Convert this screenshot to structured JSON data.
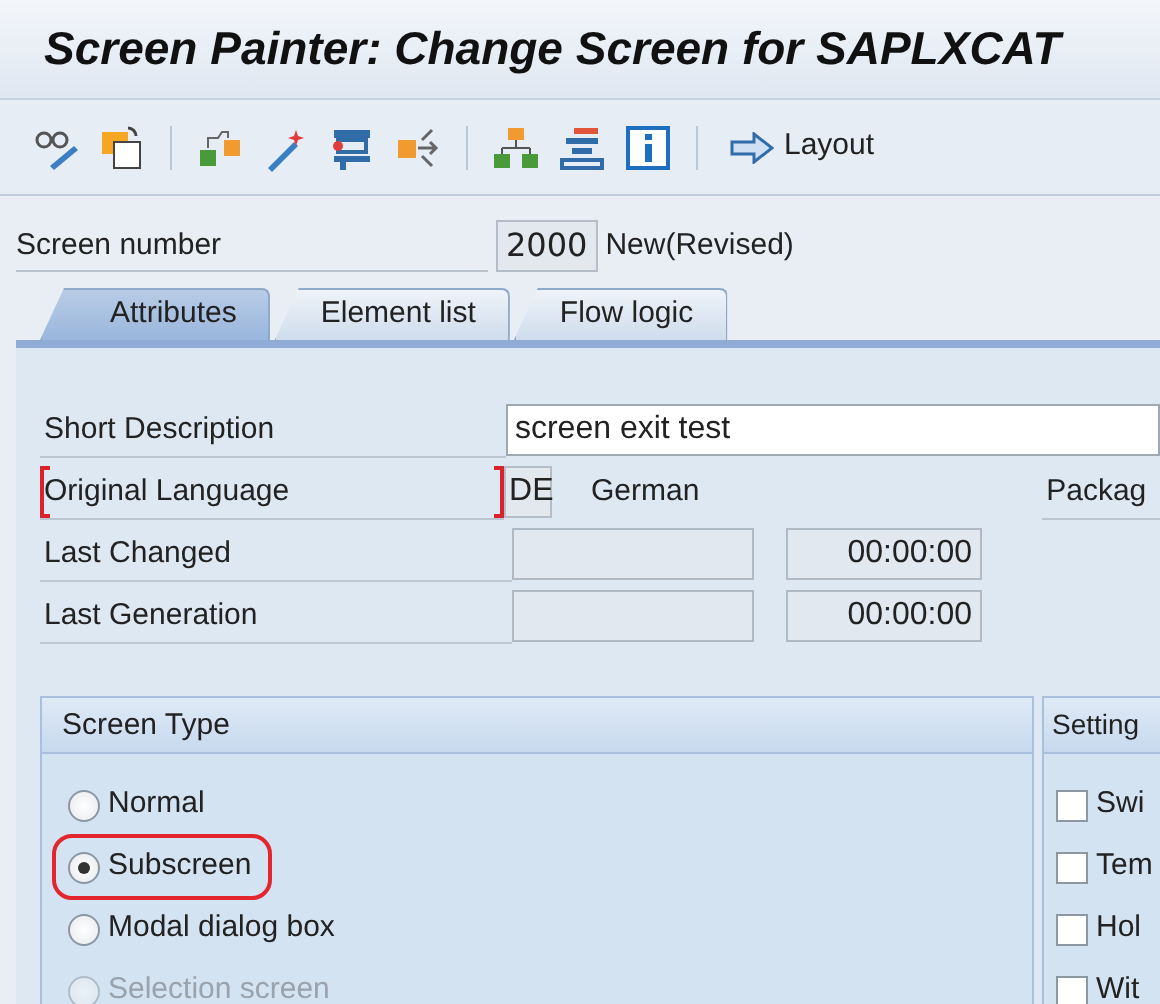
{
  "window": {
    "title": "Screen Painter: Change Screen for SAPLXCAT"
  },
  "toolbar": {
    "layout_button": "Layout"
  },
  "screen_number": {
    "label": "Screen number",
    "value": "2000",
    "status": "New(Revised)"
  },
  "tabs": [
    {
      "label": "Attributes",
      "selected": true
    },
    {
      "label": "Element list",
      "selected": false
    },
    {
      "label": "Flow logic",
      "selected": false
    }
  ],
  "attributes": {
    "fields": [
      {
        "kind": "text",
        "label": "Short Description",
        "value": "screen exit test",
        "focused": false
      },
      {
        "kind": "language",
        "label": "Original Language",
        "value": "DE",
        "description": "German",
        "focused": true
      },
      {
        "kind": "datetime",
        "label": "Last Changed",
        "time": "00:00:00",
        "focused": false
      },
      {
        "kind": "datetime",
        "label": "Last Generation",
        "time": "00:00:00",
        "focused": false
      }
    ],
    "package_label": "Packag"
  },
  "screen_type": {
    "title": "Screen Type",
    "options": [
      {
        "label": "Normal",
        "selected": false,
        "disabled": false,
        "highlighted": false
      },
      {
        "label": "Subscreen",
        "selected": true,
        "disabled": false,
        "highlighted": true
      },
      {
        "label": "Modal dialog box",
        "selected": false,
        "disabled": false,
        "highlighted": false
      },
      {
        "label": "Selection screen",
        "selected": false,
        "disabled": true,
        "highlighted": false
      }
    ]
  },
  "settings": {
    "title": "Setting",
    "options": [
      {
        "label": "Swi",
        "checked": false
      },
      {
        "label": "Tem",
        "checked": false
      },
      {
        "label": "Hol",
        "checked": false
      },
      {
        "label": "Wit",
        "checked": false
      }
    ]
  }
}
